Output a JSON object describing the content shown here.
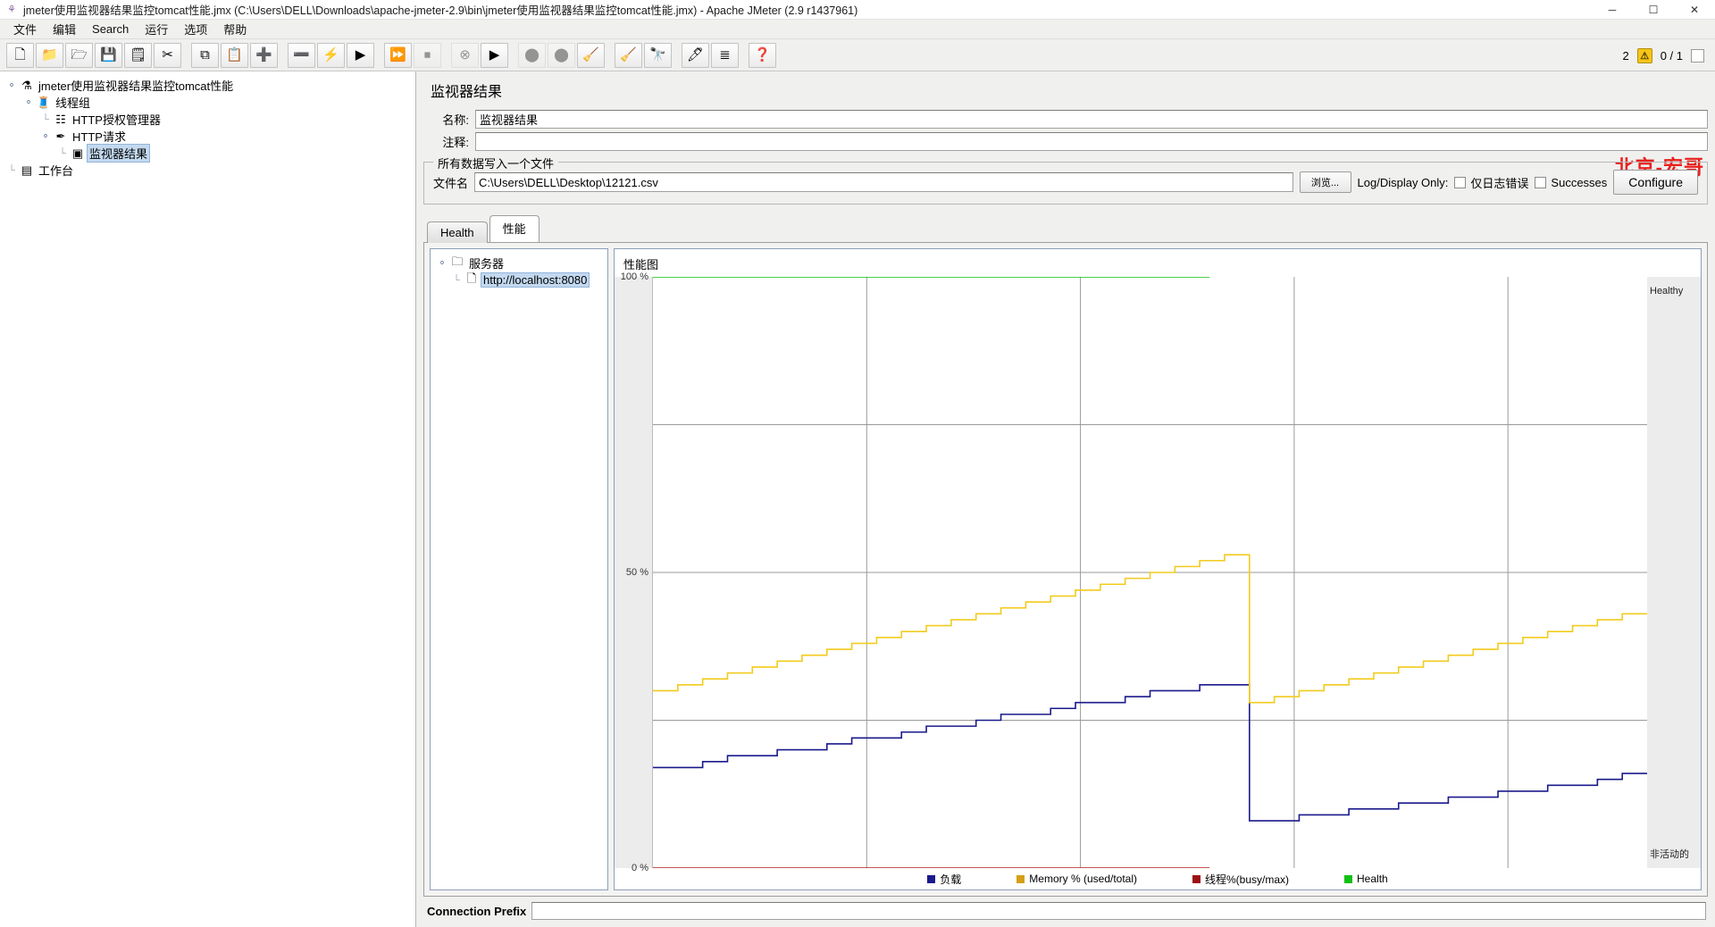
{
  "window": {
    "title": "jmeter使用监视器结果监控tomcat性能.jmx (C:\\Users\\DELL\\Downloads\\apache-jmeter-2.9\\bin\\jmeter使用监视器结果监控tomcat性能.jmx) - Apache JMeter (2.9 r1437961)",
    "app_icon": "jmeter-icon",
    "minimize": "─",
    "maximize": "☐",
    "close": "✕"
  },
  "menubar": {
    "items": [
      {
        "label": "文件"
      },
      {
        "label": "编辑"
      },
      {
        "label": "Search"
      },
      {
        "label": "运行"
      },
      {
        "label": "选项"
      },
      {
        "label": "帮助"
      }
    ]
  },
  "toolbar": {
    "buttons": [
      {
        "name": "new-test-plan",
        "glyph": "🗋",
        "disabled": false
      },
      {
        "name": "open-template",
        "glyph": "📁",
        "disabled": false
      },
      {
        "name": "open-file",
        "glyph": "🗁",
        "disabled": false
      },
      {
        "name": "save-test-plan",
        "glyph": "💾",
        "disabled": false
      },
      {
        "name": "save-as-image",
        "glyph": "🗒",
        "disabled": false
      },
      {
        "name": "cut",
        "glyph": "✂",
        "disabled": false
      },
      {
        "name": "copy",
        "glyph": "⧉",
        "disabled": false
      },
      {
        "name": "paste",
        "glyph": "📋",
        "disabled": false
      },
      {
        "name": "expand-all",
        "glyph": "➕",
        "disabled": false
      },
      {
        "name": "collapse-all",
        "glyph": "➖",
        "disabled": false
      },
      {
        "name": "toggle",
        "glyph": "⚡",
        "disabled": false
      },
      {
        "name": "start",
        "glyph": "▶",
        "disabled": false
      },
      {
        "name": "start-no-timers",
        "glyph": "⏩",
        "disabled": false
      },
      {
        "name": "stop",
        "glyph": "⏹",
        "disabled": true
      },
      {
        "name": "shutdown",
        "glyph": "⊗",
        "disabled": true
      },
      {
        "name": "remote-start-all",
        "glyph": "▶",
        "disabled": false
      },
      {
        "name": "remote-stop-all",
        "glyph": "⬤",
        "disabled": true
      },
      {
        "name": "remote-shutdown-all",
        "glyph": "⬤",
        "disabled": true
      },
      {
        "name": "clear",
        "glyph": "🧹",
        "disabled": false
      },
      {
        "name": "clear-all",
        "glyph": "🧹",
        "disabled": false
      },
      {
        "name": "search",
        "glyph": "🔭",
        "disabled": false
      },
      {
        "name": "search-reset",
        "glyph": "🖊",
        "disabled": false
      },
      {
        "name": "function-helper",
        "glyph": "≣",
        "disabled": false
      },
      {
        "name": "help",
        "glyph": "❓",
        "disabled": false
      }
    ],
    "warning_count": "2",
    "warning_glyph": "⚠",
    "thread_counter": "0 / 1"
  },
  "tree": {
    "nodes": [
      {
        "label": "jmeter使用监视器结果监控tomcat性能",
        "icon": "test-plan-icon",
        "glyph": "⚗",
        "depth": 0,
        "expander": "⚬",
        "selected": false
      },
      {
        "label": "线程组",
        "icon": "thread-group-icon",
        "glyph": "🧵",
        "depth": 1,
        "expander": "⚬",
        "selected": false
      },
      {
        "label": "HTTP授权管理器",
        "icon": "http-auth-manager-icon",
        "glyph": "☷",
        "depth": 2,
        "expander": "",
        "selected": false
      },
      {
        "label": "HTTP请求",
        "icon": "http-request-icon",
        "glyph": "✒",
        "depth": 2,
        "expander": "⚬",
        "selected": false
      },
      {
        "label": "监视器结果",
        "icon": "monitor-results-icon",
        "glyph": "▣",
        "depth": 3,
        "expander": "",
        "selected": true
      },
      {
        "label": "工作台",
        "icon": "workbench-icon",
        "glyph": "▤",
        "depth": 0,
        "expander": "",
        "selected": false
      }
    ]
  },
  "editor": {
    "watermark": "北京-宏哥",
    "panel_title": "监视器结果",
    "name_label": "名称:",
    "name_value": "监视器结果",
    "comment_label": "注释:",
    "comment_value": "",
    "file_group_title": "所有数据写入一个文件",
    "filename_label": "文件名",
    "filename_value": "C:\\Users\\DELL\\Desktop\\12121.csv",
    "browse_button": "浏览...",
    "log_display_label": "Log/Display Only:",
    "errors_only_label": "仅日志错误",
    "successes_label": "Successes",
    "configure_button": "Configure"
  },
  "tabs": [
    {
      "label": "Health",
      "active": false
    },
    {
      "label": "性能",
      "active": true
    }
  ],
  "server_tree": {
    "root_label": "服务器",
    "root_glyph": "🗀",
    "expander": "⚬",
    "items": [
      {
        "label": "http://localhost:8080",
        "glyph": "🗋",
        "selected": true
      }
    ]
  },
  "performance": {
    "title": "性能图",
    "right_top_label": "Healthy",
    "right_bottom_label": "非活动的"
  },
  "bottom": {
    "connection_prefix_label": "Connection Prefix",
    "connection_prefix_value": ""
  },
  "chart_data": {
    "type": "line",
    "title": "性能图",
    "xlabel": "",
    "ylabel": "",
    "ylim": [
      0,
      100
    ],
    "yticks": [
      "0 %",
      "50 %",
      "100 %"
    ],
    "ytick_values": [
      0,
      50,
      100
    ],
    "grid": true,
    "legend_position": "bottom",
    "annotations": [
      {
        "text": "Healthy",
        "position": "right-top"
      },
      {
        "text": "非活动的",
        "position": "right-bottom"
      }
    ],
    "colors": {
      "load": "#1a1a8c",
      "memory": "#f2cb1d",
      "threads": "#b81c1c",
      "health": "#12c012"
    },
    "series": [
      {
        "name": "负载",
        "color": "#1a1a8c",
        "step": true,
        "values": [
          17,
          17,
          18,
          19,
          19,
          20,
          20,
          21,
          22,
          22,
          23,
          24,
          24,
          25,
          26,
          26,
          27,
          28,
          28,
          29,
          30,
          30,
          31,
          31,
          8,
          8,
          9,
          9,
          10,
          10,
          11,
          11,
          12,
          12,
          13,
          13,
          14,
          14,
          15,
          16
        ]
      },
      {
        "name": "Memory % (used/total)",
        "color": "#f2cb1d",
        "step": true,
        "values": [
          30,
          31,
          32,
          33,
          34,
          35,
          36,
          37,
          38,
          39,
          40,
          41,
          42,
          43,
          44,
          45,
          46,
          47,
          48,
          49,
          50,
          51,
          52,
          53,
          28,
          29,
          30,
          31,
          32,
          33,
          34,
          35,
          36,
          37,
          38,
          39,
          40,
          41,
          42,
          43
        ]
      },
      {
        "name": "线程%(busy/max)",
        "color": "#b81c1c",
        "step": true,
        "values": [
          0,
          0,
          0,
          0,
          0,
          0,
          0,
          0,
          0,
          0,
          0,
          0,
          0,
          0,
          0,
          0,
          0,
          0,
          0,
          0,
          0,
          0,
          0,
          0,
          0,
          0,
          0,
          0,
          0,
          0,
          0,
          0,
          0,
          0,
          0,
          0,
          0,
          0,
          0,
          0
        ]
      },
      {
        "name": "Health",
        "color": "#12c012",
        "step": true,
        "values": [
          100,
          100,
          100,
          100,
          100,
          100,
          100,
          100,
          100,
          100,
          100,
          100,
          100,
          100,
          100,
          100,
          100,
          100,
          100,
          100,
          100,
          100,
          100,
          100,
          100,
          100,
          100,
          100,
          100,
          100,
          100,
          100,
          100,
          100,
          100,
          100,
          100,
          100,
          100,
          100
        ]
      }
    ],
    "legend": [
      {
        "label": "负载",
        "color": "#1a1a8c"
      },
      {
        "label": "Memory % (used/total)",
        "color": "#d4a017"
      },
      {
        "label": "线程%(busy/max)",
        "color": "#9e1111"
      },
      {
        "label": "Health",
        "color": "#12c012"
      }
    ],
    "series_extent": {
      "memory_end_x_frac": 0.56,
      "health_end_x_frac": 0.56
    }
  }
}
